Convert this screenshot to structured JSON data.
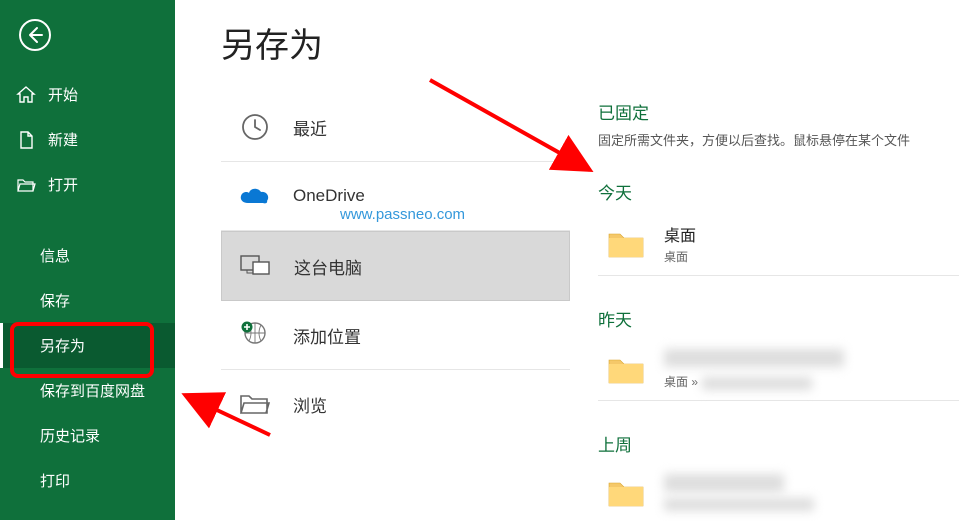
{
  "sidebar": {
    "items": [
      {
        "label": "开始"
      },
      {
        "label": "新建"
      },
      {
        "label": "打开"
      },
      {
        "label": "信息"
      },
      {
        "label": "保存"
      },
      {
        "label": "另存为"
      },
      {
        "label": "保存到百度网盘"
      },
      {
        "label": "历史记录"
      },
      {
        "label": "打印"
      }
    ]
  },
  "page": {
    "title": "另存为"
  },
  "locations": {
    "recent": "最近",
    "onedrive": "OneDrive",
    "this_pc": "这台电脑",
    "add_place": "添加位置",
    "browse": "浏览"
  },
  "recent": {
    "pinned_title": "已固定",
    "pinned_desc": "固定所需文件夹，方便以后查找。鼠标悬停在某个文件",
    "today": "今天",
    "yesterday": "昨天",
    "last_week": "上周",
    "folders": [
      {
        "name": "桌面",
        "path": "桌面"
      },
      {
        "name": "blurred",
        "path": "桌面 »"
      },
      {
        "name": "blurred",
        "path": "blurred"
      }
    ]
  },
  "watermark": "www.passneo.com"
}
